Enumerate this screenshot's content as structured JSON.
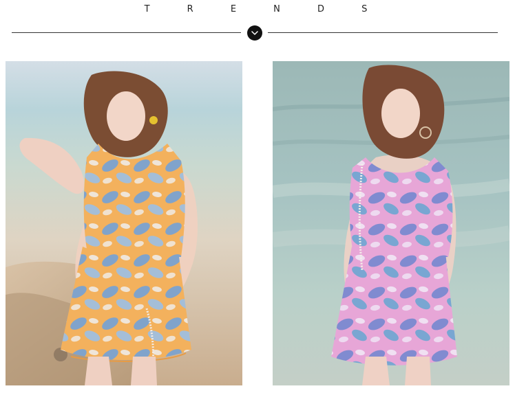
{
  "header": {
    "title": "T R E N D S",
    "chevron_icon": "chevron-down-icon"
  },
  "gallery": {
    "items": [
      {
        "name": "model-photo-orange",
        "print_color": "#f2b15a",
        "leaf_color": "#6f9fd6"
      },
      {
        "name": "model-photo-pink",
        "print_color": "#e6a7d8",
        "leaf_color": "#6f86cf"
      }
    ]
  },
  "colors": {
    "sky_left": "#c7d6e1",
    "sea_left": "#b7d2d6",
    "sand_left": "#d9c2a7",
    "sea_right": "#a7c2c3",
    "foam_right": "#d7e1dc"
  }
}
